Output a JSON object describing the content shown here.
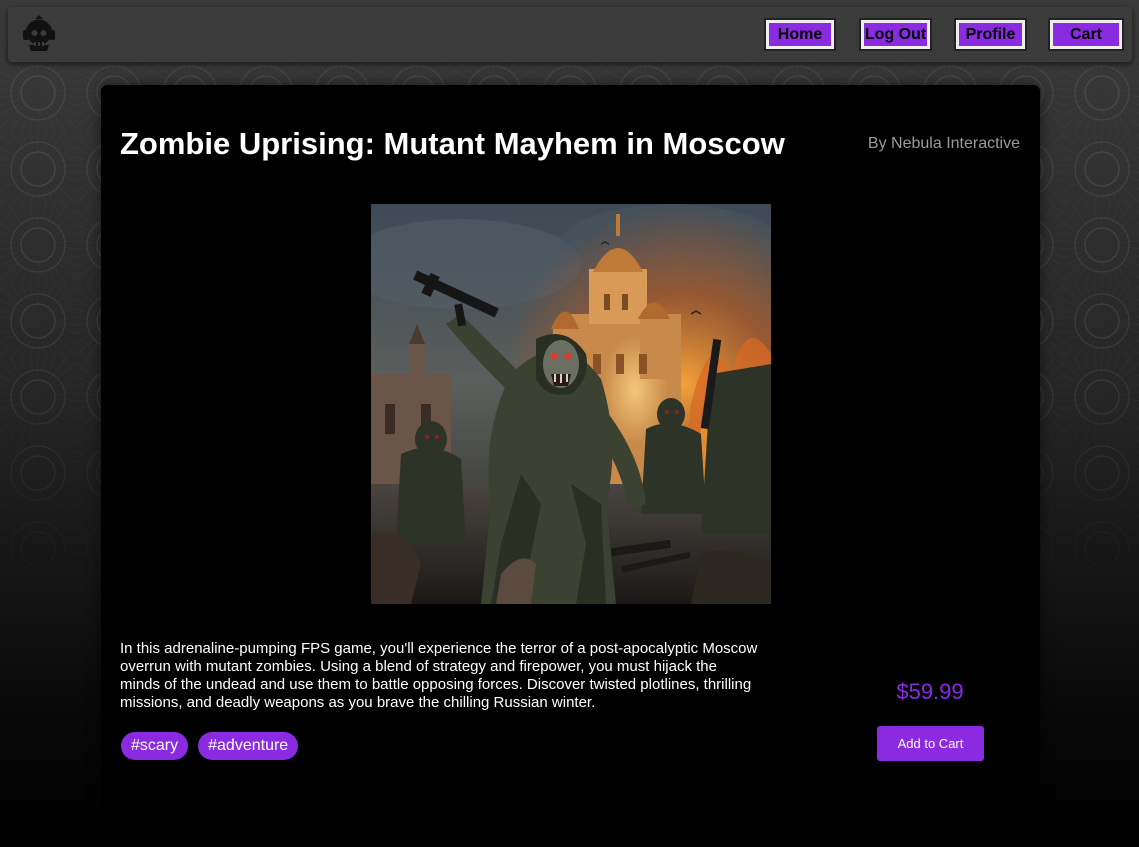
{
  "nav": {
    "home_label": "Home",
    "logout_label": "Log Out",
    "profile_label": "Profile",
    "cart_label": "Cart",
    "logo_icon": "skull-gamer-logo-icon"
  },
  "game": {
    "title": "Zombie Uprising: Mutant Mayhem in Moscow",
    "publisher": "By Nebula Interactive",
    "description": "In this adrenaline-pumping FPS game, you'll experience the terror of a post-apocalyptic Moscow overrun with mutant zombies. Using a blend of strategy and firepower, you must hijack the minds of the undead and use them to battle opposing forces. Discover twisted plotlines, thrilling missions, and deadly weapons as you brave the chilling Russian winter.",
    "tags": [
      "#scary",
      "#adventure"
    ],
    "price": "$59.99",
    "add_to_cart_label": "Add to Cart"
  },
  "colors": {
    "accent": "#8a2be2",
    "card_bg": "#000000",
    "nav_bg": "#3b3b3b",
    "publisher_text": "#9a9a9a"
  }
}
